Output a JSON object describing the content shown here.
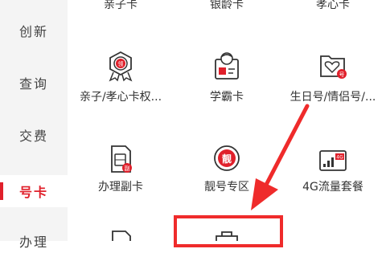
{
  "sidebar": {
    "items": [
      {
        "label": "创新"
      },
      {
        "label": "查询"
      },
      {
        "label": "交费"
      },
      {
        "label": "号卡"
      },
      {
        "label": "办理"
      }
    ],
    "active_index": 3
  },
  "grid": {
    "top_row_partial": [
      {
        "label": "亲子卡"
      },
      {
        "label": "银龄卡"
      },
      {
        "label": "孝心卡"
      }
    ],
    "items": [
      {
        "label": "亲子/孝心卡权...",
        "icon": "badge-ribbon-icon",
        "icon_text": "领"
      },
      {
        "label": "学霸卡",
        "icon": "student-card-icon"
      },
      {
        "label": "生日号/情侣号/...",
        "icon": "heart-folder-icon",
        "icon_text": "号"
      },
      {
        "label": "办理副卡",
        "icon": "sim-card-icon",
        "icon_text": "副"
      },
      {
        "label": "靓号专区",
        "icon": "special-number-icon",
        "icon_text": "靓"
      },
      {
        "label": "4G流量套餐",
        "icon": "4g-data-icon",
        "icon_text": "4G"
      }
    ]
  },
  "colors": {
    "accent": "#e0202b",
    "annotation": "#ef2b2b"
  }
}
